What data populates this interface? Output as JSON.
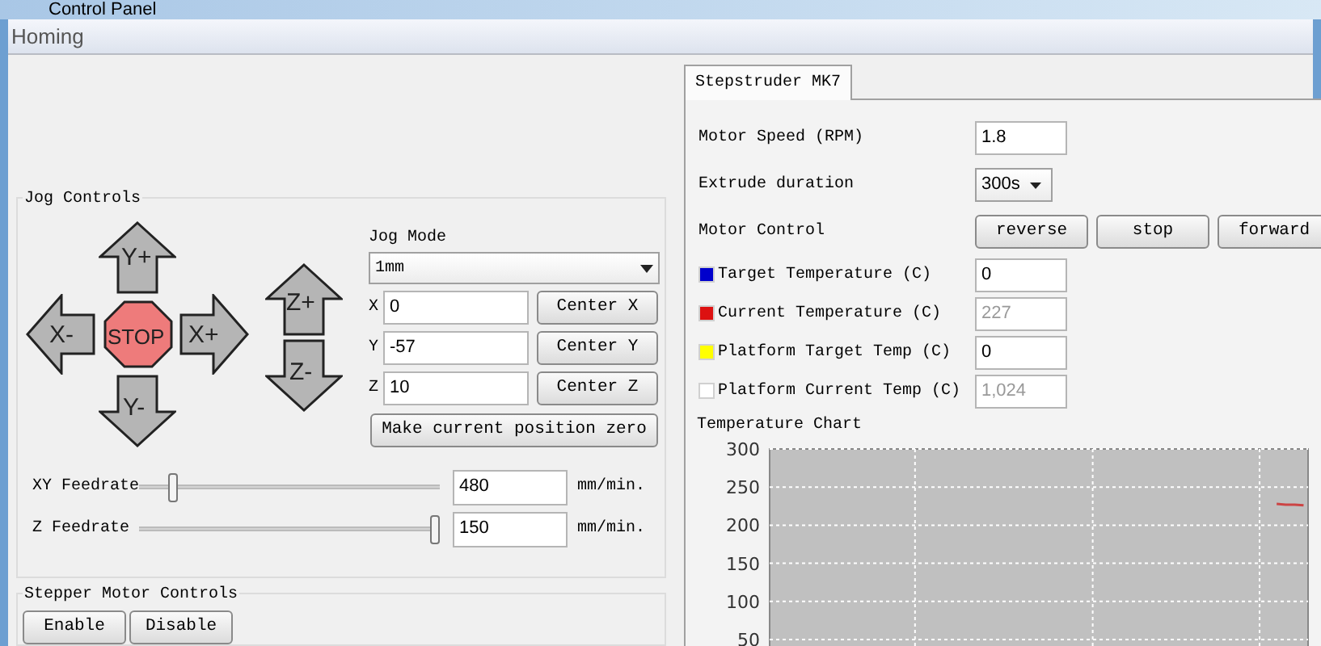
{
  "window": {
    "title": "Control Panel"
  },
  "menu": [
    {
      "label": "Homing"
    }
  ],
  "jog_controls": {
    "title": "Jog Controls",
    "pad": {
      "y_plus": "Y+",
      "x_minus": "X-",
      "stop": "STOP",
      "x_plus": "X+",
      "y_minus": "Y-",
      "z_plus": "Z+",
      "z_minus": "Z-"
    },
    "jog_mode": {
      "label": "Jog Mode",
      "value": "1mm"
    },
    "positions": [
      {
        "axis": "X",
        "value": "0",
        "button": "Center X"
      },
      {
        "axis": "Y",
        "value": "-57",
        "button": "Center Y"
      },
      {
        "axis": "Z",
        "value": "10",
        "button": "Center Z"
      }
    ],
    "zero_button": "Make current position zero",
    "feedrates": [
      {
        "label": "XY Feedrate",
        "level": 0.1,
        "value": "480",
        "unit": "mm/min."
      },
      {
        "label": "Z Feedrate",
        "level": 1.0,
        "value": "150",
        "unit": "mm/min."
      }
    ]
  },
  "stepper": {
    "title": "Stepper Motor Controls",
    "buttons": [
      "Enable",
      "Disable"
    ]
  },
  "extruder": {
    "tabs": [
      {
        "label": "Stepstruder MK7",
        "selected": true
      }
    ],
    "rows": [
      {
        "kind": "input",
        "label": "Motor Speed (RPM)",
        "value": "1.8"
      },
      {
        "kind": "select",
        "label": "Extrude duration",
        "value": "300s"
      },
      {
        "kind": "buttons",
        "label": "Motor Control",
        "buttons": [
          "reverse",
          "stop",
          "forward"
        ]
      },
      {
        "kind": "temp",
        "label": "Target Temperature (C)",
        "color": "#0000cc",
        "value": "0",
        "disabled": false
      },
      {
        "kind": "temp",
        "label": "Current Temperature (C)",
        "color": "#dd1111",
        "value": "227",
        "disabled": true
      },
      {
        "kind": "temp",
        "label": "Platform Target Temp (C)",
        "color": "#ffff00",
        "value": "0",
        "disabled": false
      },
      {
        "kind": "temp",
        "label": "Platform Current Temp (C)",
        "color": "#ffffff",
        "value": "1,024",
        "disabled": true
      }
    ],
    "chart_title": "Temperature Chart",
    "chart_data": {
      "type": "line",
      "grid": true,
      "ylim": [
        0,
        300
      ],
      "yticks": [
        {
          "value": 50,
          "label": "50"
        },
        {
          "value": 100,
          "label": "100"
        },
        {
          "value": 150,
          "label": "150"
        },
        {
          "value": 200,
          "label": "200"
        },
        {
          "value": 250,
          "label": "250"
        },
        {
          "value": 300,
          "label": "300"
        }
      ],
      "categories": [
        null,
        null,
        null,
        null,
        null,
        null,
        null,
        null,
        null,
        null,
        null,
        null,
        null,
        null,
        null,
        null,
        null,
        null,
        null,
        null,
        null,
        null,
        null,
        null,
        null,
        null,
        null,
        null,
        null,
        null,
        null,
        null,
        null,
        null,
        null,
        null,
        null,
        null,
        null,
        null,
        null,
        null,
        null,
        null,
        null,
        null,
        null,
        null,
        null,
        null,
        null,
        null,
        null,
        null,
        null,
        null,
        null,
        null,
        null,
        null
      ],
      "series": [
        {
          "color": "#cc4444",
          "values": [
            null,
            null,
            null,
            null,
            null,
            null,
            null,
            null,
            null,
            null,
            null,
            null,
            null,
            null,
            null,
            null,
            null,
            null,
            null,
            null,
            null,
            null,
            null,
            null,
            null,
            null,
            null,
            null,
            null,
            null,
            null,
            null,
            null,
            null,
            null,
            null,
            null,
            null,
            null,
            null,
            null,
            null,
            null,
            null,
            null,
            null,
            null,
            null,
            null,
            null,
            null,
            null,
            null,
            null,
            null,
            null,
            228,
            227,
            227,
            226
          ]
        }
      ]
    }
  }
}
